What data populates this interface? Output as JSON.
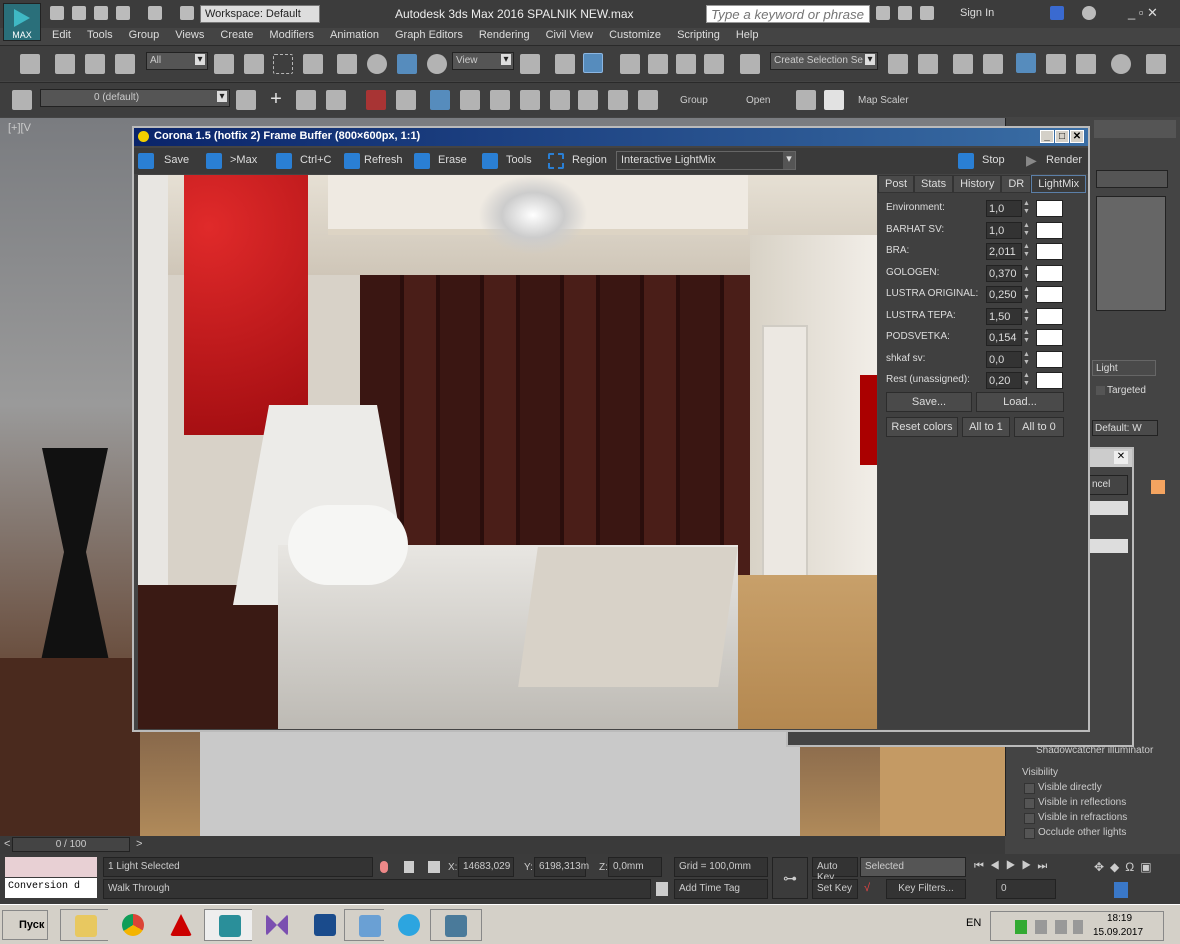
{
  "app": {
    "title": "Autodesk 3ds Max 2016    SPALNIK  NEW.max",
    "logo": "MAX",
    "workspace": "Workspace: Default",
    "search_placeholder": "Type a keyword or phrase",
    "sign_in": "Sign In"
  },
  "menu": [
    "Edit",
    "Tools",
    "Group",
    "Views",
    "Create",
    "Modifiers",
    "Animation",
    "Graph Editors",
    "Rendering",
    "Civil View",
    "Customize",
    "Scripting",
    "Help"
  ],
  "toolbar1": {
    "filter": "All",
    "ref_coord": "View",
    "selection_set": "Create Selection Se"
  },
  "toolbar2": {
    "layer": "0 (default)",
    "group": "Group",
    "open": "Open",
    "map_scaler": "Map Scaler"
  },
  "viewport": {
    "label": "[+][V"
  },
  "framebuffer": {
    "title": "Corona 1.5 (hotfix 2) Frame Buffer (800×600px, 1:1)",
    "buttons": {
      "save": "Save",
      "max": ">Max",
      "copy": "Ctrl+C",
      "refresh": "Refresh",
      "erase": "Erase",
      "tools": "Tools",
      "region": "Region",
      "stop": "Stop",
      "render": "Render"
    },
    "mode": "Interactive LightMix",
    "tabs": [
      "Post",
      "Stats",
      "History",
      "DR",
      "LightMix"
    ],
    "active_tab": "LightMix",
    "lights": [
      {
        "name": "Environment:",
        "value": "1,0"
      },
      {
        "name": "BARHAT SV:",
        "value": "1,0"
      },
      {
        "name": "BRA:",
        "value": "2,011"
      },
      {
        "name": "GOLOGEN:",
        "value": "0,370"
      },
      {
        "name": "LUSTRA ORIGINAL:",
        "value": "0,250"
      },
      {
        "name": "LUSTRA TEPA:",
        "value": "1,50"
      },
      {
        "name": "PODSVETKA:",
        "value": "0,154"
      },
      {
        "name": "shkaf sv:",
        "value": "0,0"
      },
      {
        "name": "Rest (unassigned):",
        "value": "0,20"
      }
    ],
    "save_btn": "Save...",
    "load_btn": "Load...",
    "reset_btn": "Reset colors",
    "all1_btn": "All to 1",
    "all0_btn": "All to 0"
  },
  "command_panel": {
    "light": "Light",
    "targeted": "Targeted",
    "default": "Default: W",
    "cancel": "ncel",
    "shadowcatcher": "Shadowcatcher illuminator",
    "visibility": "Visibility",
    "visibility_items": [
      "Visible directly",
      "Visible in reflections",
      "Visible in refractions",
      "Occlude other lights"
    ]
  },
  "timeline": {
    "frame": "0 / 100"
  },
  "status": {
    "selected": "1 Light Selected",
    "script": "Conversion d",
    "prompt": "Walk Through",
    "x": "14683,029",
    "y": "6198,313m",
    "z": "0,0mm",
    "grid": "Grid = 100,0mm",
    "add_time_tag": "Add Time Tag",
    "auto_key": "Auto Key",
    "set_key": "Set Key",
    "key_mode": "Selected",
    "key_filters": "Key Filters...",
    "current_frame": "0"
  },
  "taskbar": {
    "start": "Пуск",
    "lang": "EN",
    "time": "18:19",
    "date": "15.09.2017",
    "apps": [
      "explorer",
      "chrome",
      "autocad",
      "3dsmax",
      "visual-studio",
      "photoshop",
      "control-panel",
      "telegram",
      "image-viewer"
    ]
  },
  "colors": {
    "fb_title": "#0a246a",
    "accent": "#2a7fd4",
    "taskbar": "#d4d0c8",
    "red_wall": "#c0141a"
  }
}
